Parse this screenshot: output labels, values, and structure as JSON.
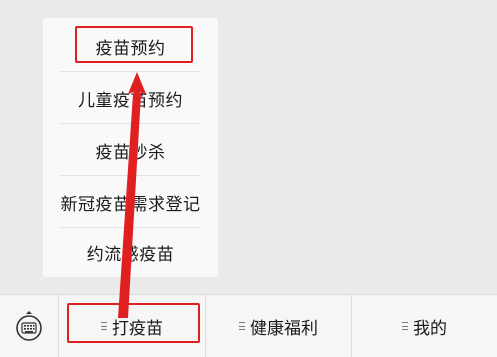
{
  "popup_menu": {
    "items": [
      {
        "label": "疫苗预约"
      },
      {
        "label": "儿童疫苗预约"
      },
      {
        "label": "疫苗秒杀"
      },
      {
        "label": "新冠疫苗需求登记"
      },
      {
        "label": "约流感疫苗"
      }
    ]
  },
  "tab_bar": {
    "keyboard_icon": "keyboard-icon",
    "tabs": [
      {
        "label": "打疫苗",
        "icon": "menu-lines-icon"
      },
      {
        "label": "健康福利",
        "icon": "menu-lines-icon"
      },
      {
        "label": "我的",
        "icon": "menu-lines-icon"
      }
    ]
  },
  "annotation": {
    "color": "#e02020"
  },
  "colors": {
    "background": "#ebebeb",
    "popup_background": "#f9f9f9",
    "tabbar_background": "#f6f6f6",
    "text": "#1a1a1a"
  }
}
